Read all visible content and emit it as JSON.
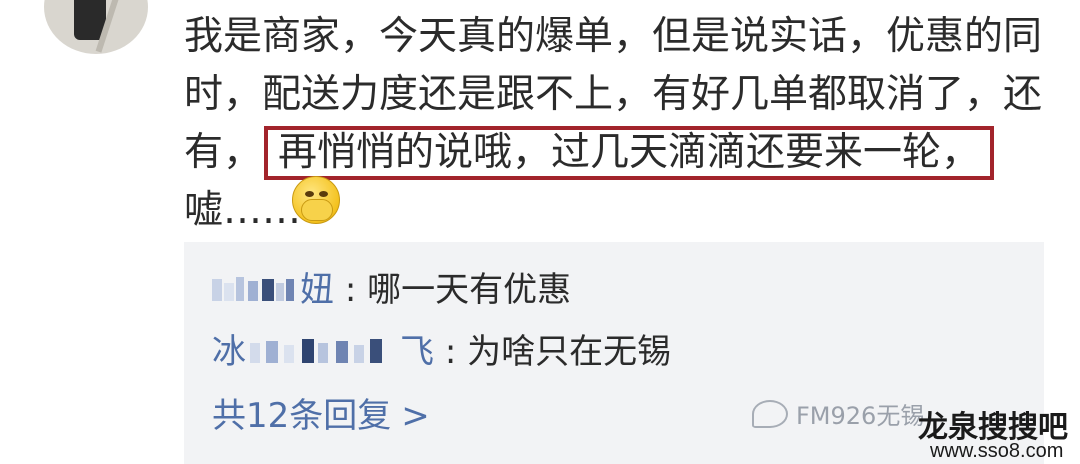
{
  "comment": {
    "line1": "我是商家，今天真的爆单，但是说实话，优惠的同",
    "line2": "时，配送力度还是跟不上，有好几单都取消了，还",
    "line3_prefix": "有，",
    "line3_highlight": "再悄悄的说哦，过几天滴滴还要来一轮，",
    "line4": "嘘……"
  },
  "replies": [
    {
      "name_visible_end": "妞",
      "text": ": 哪一天有优惠"
    },
    {
      "name_visible_start": "冰",
      "name_visible_end": "飞",
      "text": ": 为啥只在无锡"
    }
  ],
  "more_replies": "共12条回复",
  "more_chevron": ">",
  "watermark": "FM926无锡",
  "logo_main": "龙泉搜搜吧",
  "logo_sub": "www.sso8.com",
  "colors": {
    "highlight_border": "#a2242b",
    "link": "#4f6fa8",
    "reply_bg": "#f2f3f5"
  },
  "icons": [
    "avatar",
    "emoji-shush-icon",
    "wechat-icon"
  ]
}
